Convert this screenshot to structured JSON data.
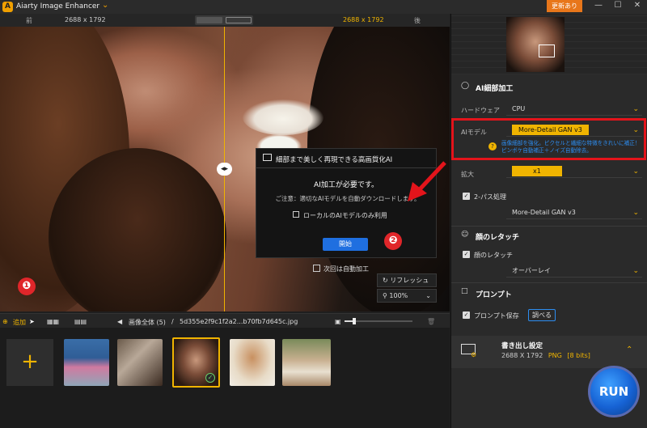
{
  "app": {
    "title": "Aiarty Image Enhancer",
    "update_label": "更新あり",
    "win_controls": [
      "—",
      "☐",
      "✕"
    ]
  },
  "compare": {
    "before_label": "前",
    "before_size": "2688 x 1792",
    "after_size": "2688 x 1792",
    "after_label": "後"
  },
  "dialog": {
    "title": "細部まで美しく再現できる高画質化AI",
    "required": "AI加工が必要です。",
    "note": "ご注意：適切なAIモデルを自動ダウンロードします。",
    "local_only_label": "ローカルのAIモデルのみ利用",
    "start_label": "開始"
  },
  "auto_process_label": "次回は自動加工",
  "refresh_label": "リフレッシュ",
  "zoom_value": "100%",
  "annotations": {
    "one": "❶",
    "two": "❷",
    "three": "❸"
  },
  "toolbar": {
    "add_label": "追加",
    "all_images": "画像全体 (5)",
    "separator": "/",
    "filename": "5d355e2f9c1f2a2...b70fb7d645c.jpg"
  },
  "thumbnails": [
    "child-umbrella",
    "cooking-person",
    "smiling-woman",
    "cartoon-boy",
    "girl-field"
  ],
  "panel": {
    "ai_detail_title": "AI細部加工",
    "hardware_label": "ハードウェア",
    "hardware_value": "CPU",
    "ai_model_label": "AIモデル",
    "ai_model_value": "More-Detail GAN  v3",
    "ai_model_desc": "画像細部を強化。ピクセルと繊細な特徴をきれいに補正！ピンボケ自動補正＋ノイズ自動除去。",
    "scale_label": "拡大",
    "scale_value": "x1",
    "two_pass_label": "2-パス処理",
    "two_pass_model": "More-Detail GAN  v3",
    "face_title": "顔のレタッチ",
    "face_label": "顔のレタッチ",
    "face_mode": "オーバーレイ",
    "prompt_title": "プロンプト",
    "prompt_save_label": "プロンプト保存",
    "prompt_check_label": "調べる",
    "export_title": "書き出し設定",
    "export_size": "2688 X 1792",
    "export_format": "PNG",
    "export_bits": "[8 bits]",
    "run_label": "RUN"
  },
  "colors": {
    "accent": "#f0b400",
    "red_mark": "#e3141b",
    "run_blue": "#1662d4",
    "link_blue": "#2d8df0"
  }
}
